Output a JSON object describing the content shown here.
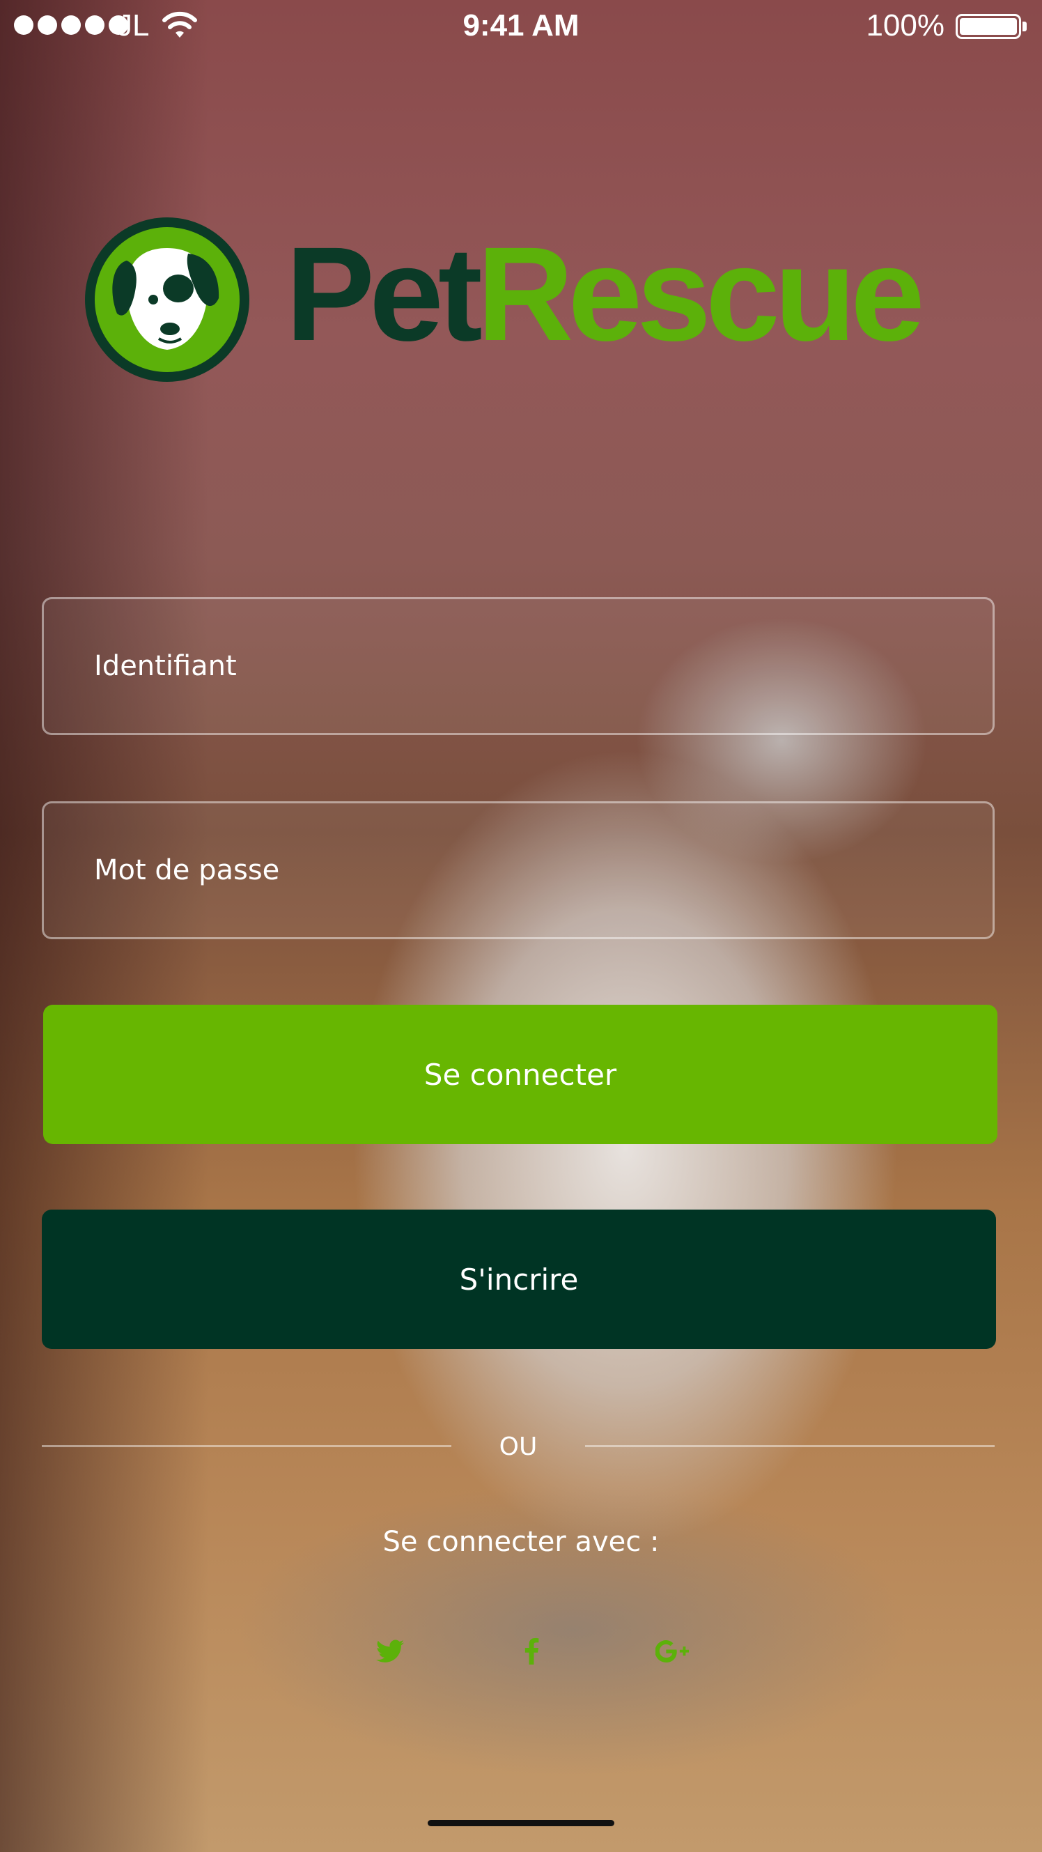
{
  "status_bar": {
    "carrier": "JL",
    "time": "9:41 AM",
    "battery_percent": "100%",
    "signal_bars": 5
  },
  "brand": {
    "name_part1": "Pet",
    "name_part2": "Rescue",
    "color_dark": "#0b3a27",
    "color_green": "#5cb10a",
    "logo_icon": "dog-face-icon"
  },
  "login_form": {
    "username_placeholder": "Identifiant",
    "password_placeholder": "Mot de passe",
    "login_button": "Se connecter",
    "signup_button": "S'incrire"
  },
  "divider": {
    "text": "OU"
  },
  "social_login": {
    "label": "Se connecter avec :",
    "providers": [
      {
        "name": "twitter",
        "icon": "twitter-icon"
      },
      {
        "name": "facebook",
        "icon": "facebook-icon"
      },
      {
        "name": "google-plus",
        "icon": "google-plus-icon"
      }
    ],
    "icon_color": "#5cb10a"
  },
  "colors": {
    "login_button_bg": "#67b601",
    "signup_button_bg": "#003424"
  }
}
